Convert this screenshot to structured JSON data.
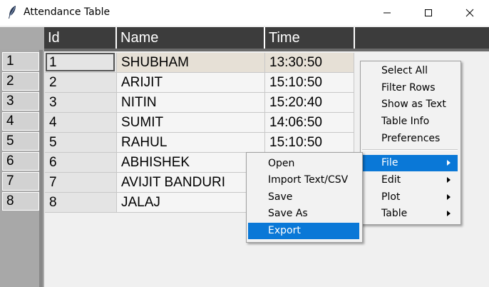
{
  "window": {
    "title": "Attendance Table",
    "icon": "feather-icon"
  },
  "table": {
    "columns": [
      "Id",
      "Name",
      "Time"
    ],
    "row_numbers": [
      "1",
      "2",
      "3",
      "4",
      "5",
      "6",
      "7",
      "8"
    ],
    "rows": [
      {
        "id": "1",
        "name": "SHUBHAM",
        "time": "13:30:50"
      },
      {
        "id": "2",
        "name": "ARIJIT",
        "time": "15:10:50"
      },
      {
        "id": "3",
        "name": "NITIN",
        "time": "15:20:40"
      },
      {
        "id": "4",
        "name": "SUMIT",
        "time": "14:06:50"
      },
      {
        "id": "5",
        "name": "RAHUL",
        "time": "15:10:50"
      },
      {
        "id": "6",
        "name": "ABHISHEK",
        "time": ""
      },
      {
        "id": "7",
        "name": "AVIJIT BANDURI",
        "time": ""
      },
      {
        "id": "8",
        "name": "JALAJ",
        "time": ""
      }
    ]
  },
  "context_menu": {
    "items": [
      "Select All",
      "Filter Rows",
      "Show as Text",
      "Table Info",
      "Preferences"
    ],
    "submenus": [
      "File",
      "Edit",
      "Plot",
      "Table"
    ],
    "highlighted": "File"
  },
  "file_menu": {
    "items": [
      "Open",
      "Import Text/CSV",
      "Save",
      "Save As",
      "Export"
    ],
    "highlighted": "Export"
  },
  "colors": {
    "highlight": "#0a78d7",
    "header_bg": "#3c3c3c",
    "row_header_bg": "#a8a8a8"
  }
}
